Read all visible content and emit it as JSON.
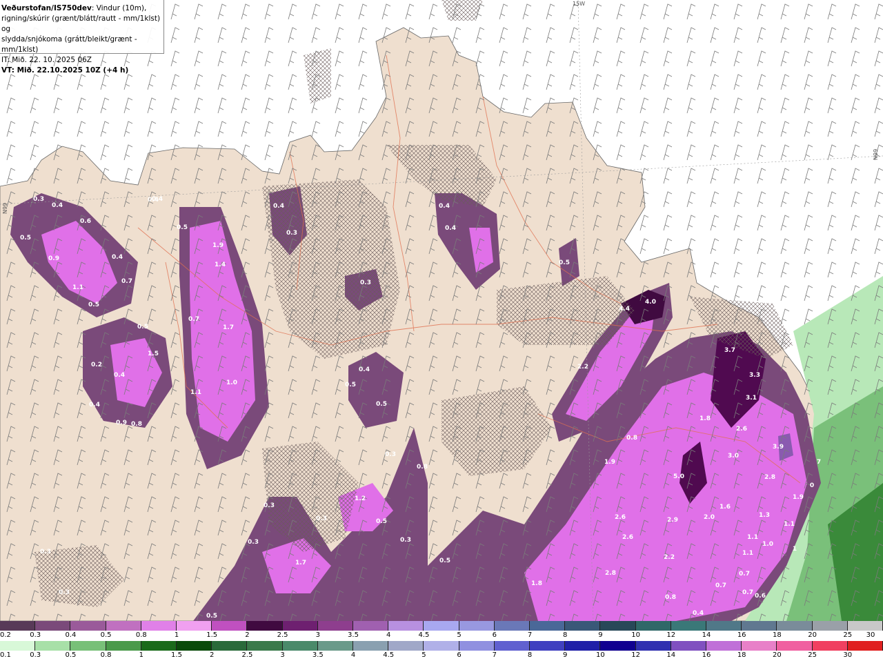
{
  "header": {
    "title_bold": "Veðurstofan/IS750dev",
    "title_rest": ": Vindur (10m),",
    "line2": "rigning/skúrir (grænt/blátt/rautt - mm/1klst) og",
    "line3": "slydda/snjókoma (grátt/bleikt/grænt - mm/1klst)",
    "line4": "IT: Mið. 22. 10. 2025 06Z",
    "line5": "VT: Mið. 22.10.2025 10Z (+4 h)"
  },
  "map": {
    "grid_labels": [
      "15W",
      "N99",
      "N99"
    ],
    "labels": [
      {
        "t": "0.3"
      },
      {
        "t": "0.4"
      },
      {
        "t": "0.6"
      },
      {
        "t": "0.5"
      },
      {
        "t": "0.9"
      },
      {
        "t": "0.4"
      },
      {
        "t": "1.1"
      },
      {
        "t": "0.7"
      },
      {
        "t": "0.5"
      },
      {
        "t": "0.4"
      },
      {
        "t": "0.5"
      },
      {
        "t": "1.9"
      },
      {
        "t": "1.4"
      },
      {
        "t": "0.7"
      },
      {
        "t": "1.7"
      },
      {
        "t": "0.5"
      },
      {
        "t": "1.5"
      },
      {
        "t": "0.2"
      },
      {
        "t": "0.4"
      },
      {
        "t": "1.0"
      },
      {
        "t": "1.1"
      },
      {
        "t": "0.4"
      },
      {
        "t": "0.9"
      },
      {
        "t": "0.8"
      },
      {
        "t": "0.4"
      },
      {
        "t": "0.3"
      },
      {
        "t": "0.3"
      },
      {
        "t": "0.4"
      },
      {
        "t": "0.4"
      },
      {
        "t": "0.4"
      },
      {
        "t": "0.5"
      },
      {
        "t": "0.4"
      },
      {
        "t": "0.5"
      },
      {
        "t": "0.5"
      },
      {
        "t": "0.8"
      },
      {
        "t": "1.2"
      },
      {
        "t": "0.5"
      },
      {
        "t": "0.3"
      },
      {
        "t": "0.3"
      },
      {
        "t": "0.3"
      },
      {
        "t": "0.3"
      },
      {
        "t": "0.3"
      },
      {
        "t": "0.3"
      },
      {
        "t": "1.7"
      },
      {
        "t": "0.5"
      },
      {
        "t": "0.3"
      },
      {
        "t": "4.4"
      },
      {
        "t": "4.0"
      },
      {
        "t": "2.2"
      },
      {
        "t": "3.7"
      },
      {
        "t": "3.3"
      },
      {
        "t": "3.1"
      },
      {
        "t": "1.8"
      },
      {
        "t": "2.6"
      },
      {
        "t": "3.0"
      },
      {
        "t": "3.9"
      },
      {
        "t": "0.8"
      },
      {
        "t": "1.9"
      },
      {
        "t": "5.0"
      },
      {
        "t": "2.8"
      },
      {
        "t": "1.9"
      },
      {
        "t": "2.6"
      },
      {
        "t": "2.9"
      },
      {
        "t": "2.0"
      },
      {
        "t": "1.6"
      },
      {
        "t": "1.3"
      },
      {
        "t": "1.1"
      },
      {
        "t": "2.6"
      },
      {
        "t": "1.1"
      },
      {
        "t": "1.0"
      },
      {
        "t": "1.1"
      },
      {
        "t": "2.2"
      },
      {
        "t": "2.8"
      },
      {
        "t": "1.8"
      },
      {
        "t": "0.7"
      },
      {
        "t": "0.7"
      },
      {
        "t": "0.4"
      },
      {
        "t": "0.6"
      },
      {
        "t": "0.5"
      },
      {
        "t": "1"
      },
      {
        "t": "0.8"
      },
      {
        "t": "0.7"
      },
      {
        "t": "0"
      },
      {
        "t": "7"
      }
    ]
  },
  "legend_snow": {
    "ticks": [
      "0.2",
      "0.3",
      "0.4",
      "0.5",
      "0.8",
      "1",
      "1.5",
      "2",
      "2.5",
      "3",
      "3.5",
      "4",
      "4.5",
      "5",
      "6",
      "7",
      "8",
      "9",
      "10",
      "12",
      "14",
      "16",
      "18",
      "20",
      "25",
      "30"
    ],
    "colors": [
      "#583a58",
      "#7a4a7a",
      "#9a5a9a",
      "#c070c0",
      "#e080e8",
      "#f0a0f0",
      "#c050c0",
      "#400a40",
      "#6e2070",
      "#8e3e8e",
      "#a060b0",
      "#b890e0",
      "#a8a8f0",
      "#9898e0",
      "#6a78b8",
      "#4a6898",
      "#3a5878",
      "#284858",
      "#306868",
      "#3a7878",
      "#507888",
      "#607890",
      "#7a8c9a",
      "#9aa0a8",
      "#c8c8c8"
    ]
  },
  "legend_rain": {
    "ticks": [
      "0.1",
      "0.3",
      "0.5",
      "0.8",
      "1",
      "1.5",
      "2",
      "2.5",
      "3",
      "3.5",
      "4",
      "4.5",
      "5",
      "6",
      "7",
      "8",
      "9",
      "10",
      "12",
      "14",
      "16",
      "18",
      "20",
      "25",
      "30"
    ],
    "colors": [
      "#d8f8d8",
      "#a8e0a8",
      "#78c078",
      "#4a9a4a",
      "#1a6a1a",
      "#0a4a0a",
      "#2a6a3a",
      "#3a7a4a",
      "#4a8a6a",
      "#6a9a8a",
      "#8aa0b0",
      "#a0a8c8",
      "#b0b0e8",
      "#9090e0",
      "#6060d0",
      "#4040c0",
      "#2020a8",
      "#100090",
      "#3030b0",
      "#8050c0",
      "#c070d8",
      "#e880c8",
      "#f060a0",
      "#f04060",
      "#e02020"
    ]
  }
}
